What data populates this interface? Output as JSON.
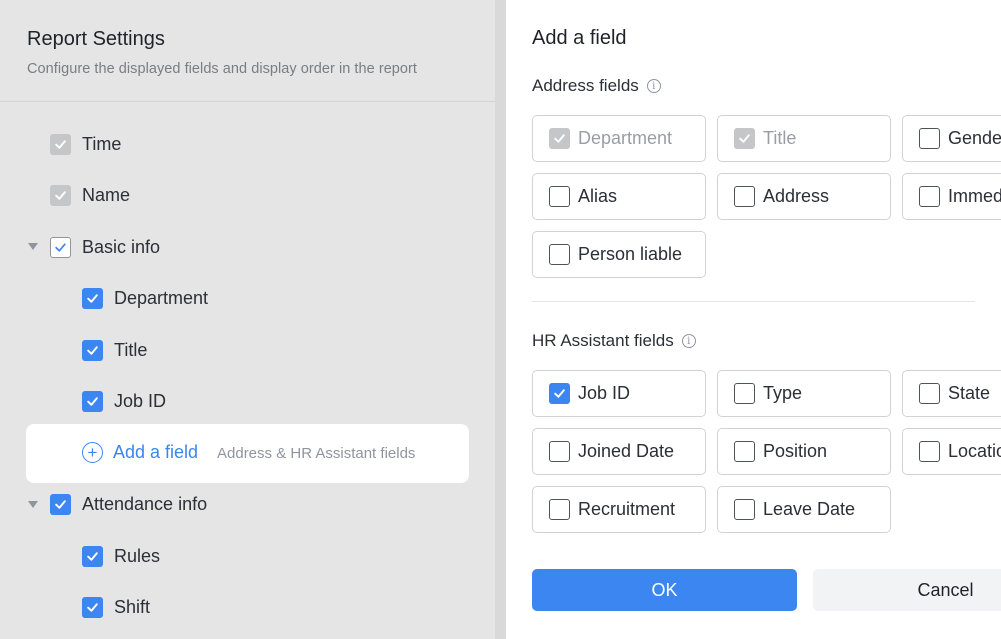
{
  "left": {
    "title": "Report Settings",
    "subtitle": "Configure the displayed fields and display order in the report",
    "items": [
      {
        "label": "Time"
      },
      {
        "label": "Name"
      },
      {
        "label": "Basic info"
      },
      {
        "label": "Department"
      },
      {
        "label": "Title"
      },
      {
        "label": "Job ID"
      },
      {
        "label": "Attendance info"
      },
      {
        "label": "Rules"
      },
      {
        "label": "Shift"
      }
    ],
    "add_field": {
      "plus": "+",
      "label": "Add a field",
      "hint": "Address & HR Assistant fields"
    }
  },
  "right": {
    "title": "Add a field",
    "address_section": {
      "title": "Address fields",
      "info": "i",
      "fields": [
        "Department",
        "Title",
        "Gender",
        "Alias",
        "Address",
        "Immediate",
        "Person liable"
      ]
    },
    "hr_section": {
      "title": "HR Assistant fields",
      "info": "i",
      "fields": [
        "Job ID",
        "Type",
        "State",
        "Joined Date",
        "Position",
        "Location",
        "Recruitment",
        "Leave Date"
      ]
    },
    "ok_label": "OK",
    "cancel_label": "Cancel"
  },
  "colors": {
    "accent": "#3b86f0",
    "disabled_check": "#c5c6c8",
    "panel_bg": "#e5e5e5"
  }
}
